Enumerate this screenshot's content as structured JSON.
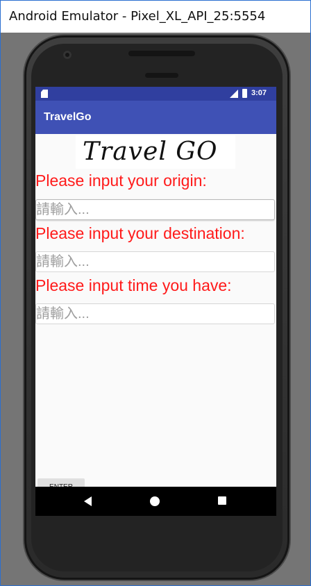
{
  "window": {
    "title": "Android Emulator - Pixel_XL_API_25:5554"
  },
  "status_bar": {
    "time": "3:07",
    "icons": [
      "sd-card-icon",
      "signal-icon",
      "battery-icon"
    ]
  },
  "app_bar": {
    "title": "TravelGo"
  },
  "logo": {
    "text": "Travel GO"
  },
  "form": {
    "origin_prompt": "Please input your origin:",
    "origin_placeholder": "請輸入...",
    "destination_prompt": "Please input your destination:",
    "destination_placeholder": "請輸入...",
    "time_prompt": "Please input time you have:",
    "time_placeholder": "請輸入...",
    "enter_label": "ENTER"
  },
  "nav_bar": {
    "icons": [
      "back-icon",
      "home-icon",
      "recents-icon"
    ]
  },
  "colors": {
    "primary": "#3f51b5",
    "primary_dark": "#303f9f",
    "prompt_text": "#ff1a1a",
    "placeholder_text": "#9e9e9e"
  }
}
